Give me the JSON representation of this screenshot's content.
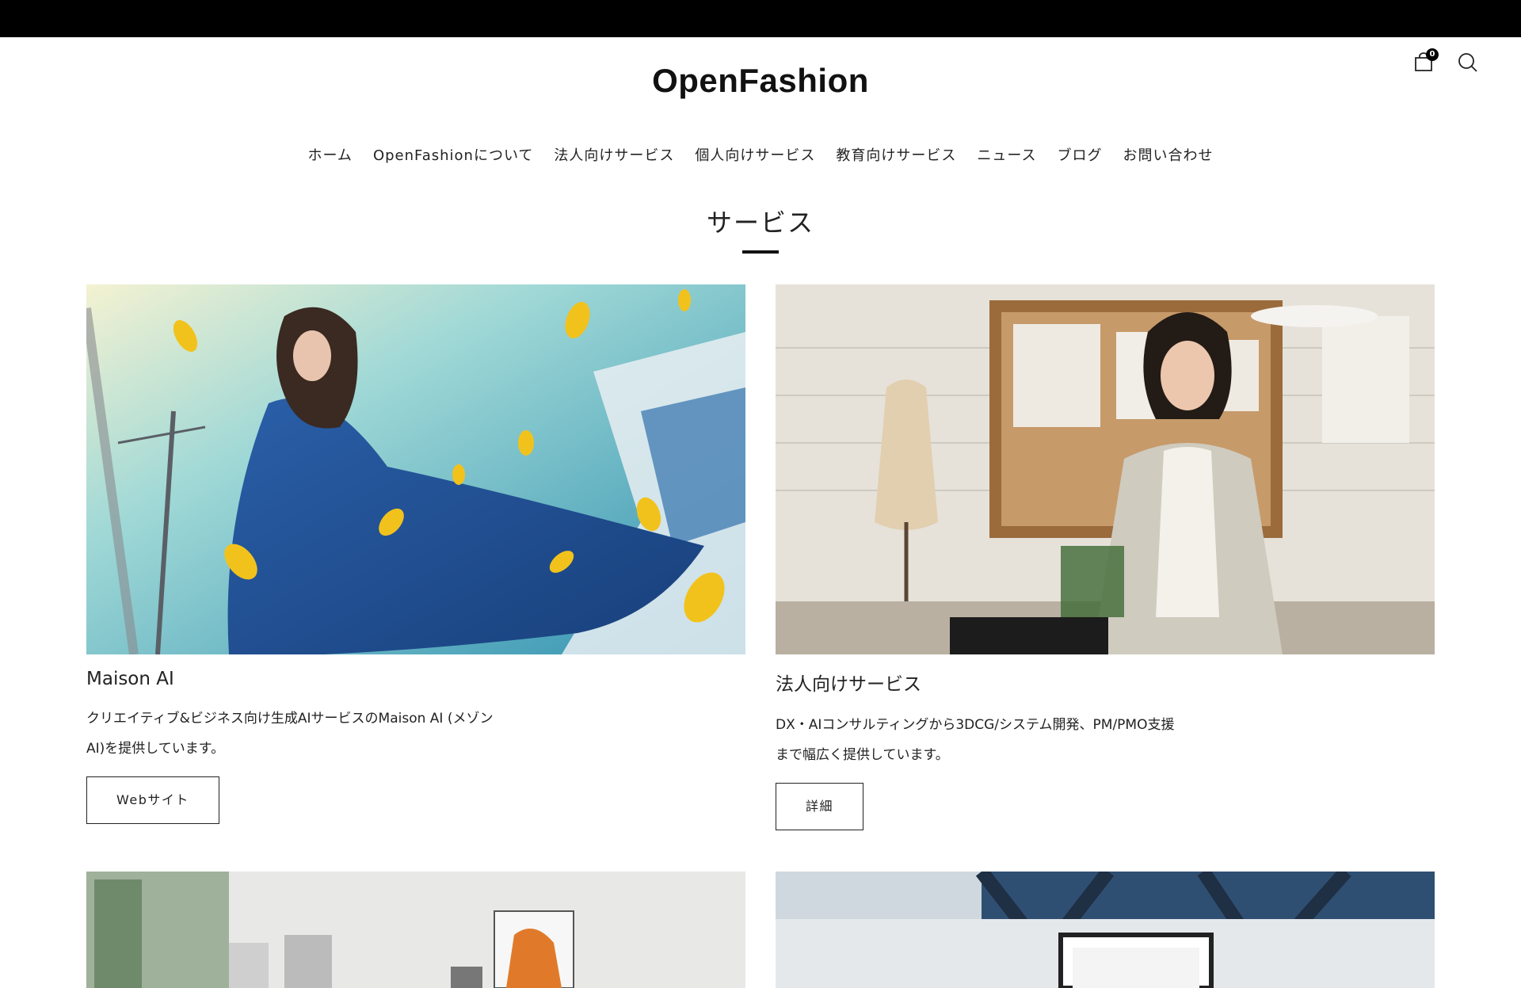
{
  "header": {
    "logo": "OpenFashion",
    "cart_count": "0",
    "icons": [
      "cart-icon",
      "search-icon"
    ]
  },
  "nav": {
    "items": [
      {
        "label": "ホーム"
      },
      {
        "label": "OpenFashionについて"
      },
      {
        "label": "法人向けサービス"
      },
      {
        "label": "個人向けサービス"
      },
      {
        "label": "教育向けサービス"
      },
      {
        "label": "ニュース"
      },
      {
        "label": "ブログ"
      },
      {
        "label": "お問い合わせ"
      }
    ]
  },
  "section": {
    "title": "サービス"
  },
  "cards": [
    {
      "title": "Maison AI",
      "desc": "クリエイティブ&ビジネス向け生成AIサービスのMaison AI (メゾンAI)を提供しています。",
      "button": "Webサイト"
    },
    {
      "title": "法人向けサービス",
      "desc": "DX・AIコンサルティングから3DCG/システム開発、PM/PMO支援まで幅広く提供しています。",
      "button": "詳細"
    }
  ],
  "colors": {
    "topbar": "#000000",
    "text": "#222222",
    "background": "#ffffff"
  }
}
